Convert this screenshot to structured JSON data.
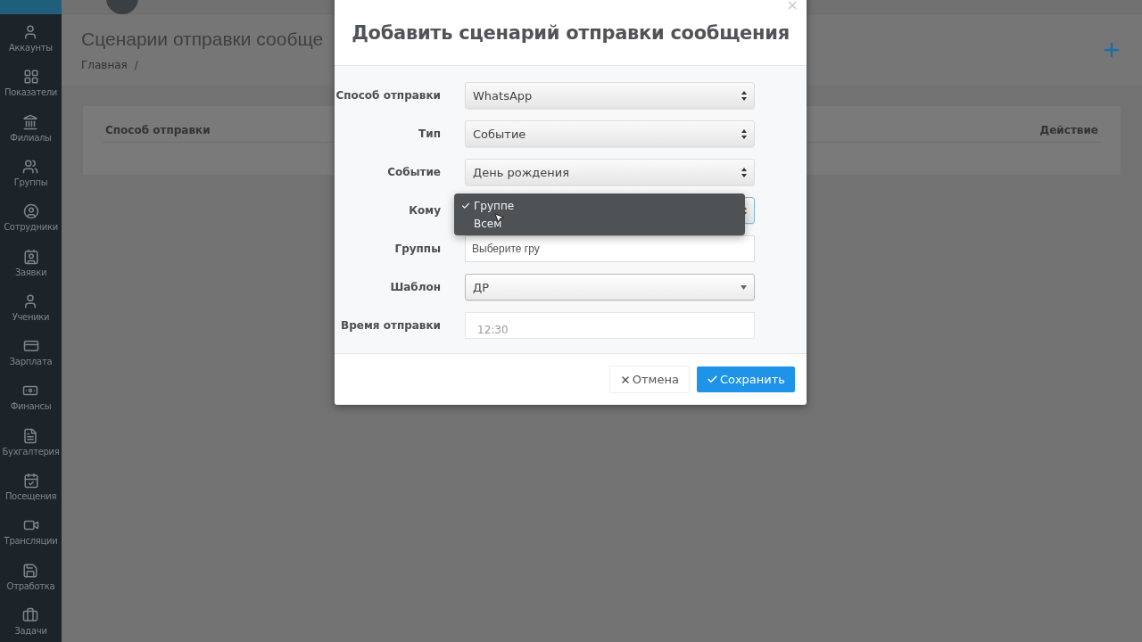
{
  "sidebar": {
    "items": [
      {
        "label": "Аккаунты"
      },
      {
        "label": "Показатели"
      },
      {
        "label": "Филиалы"
      },
      {
        "label": "Группы"
      },
      {
        "label": "Сотрудники"
      },
      {
        "label": "Заявки"
      },
      {
        "label": "Ученики"
      },
      {
        "label": "Зарплата"
      },
      {
        "label": "Финансы"
      },
      {
        "label": "Бухгалтерия"
      },
      {
        "label": "Посещения"
      },
      {
        "label": "Трансляции"
      },
      {
        "label": "Отработка"
      },
      {
        "label": "Задачи"
      }
    ]
  },
  "page": {
    "title": "Сценарии отправки сообще",
    "breadcrumb": "Главная",
    "breadcrumb_separator": "/"
  },
  "table": {
    "columns": [
      "Способ отправки",
      "Действие"
    ]
  },
  "modal": {
    "title": "Добавить сценарий отправки сообщения",
    "close": "×",
    "fields": [
      {
        "label": "Способ отправки",
        "kind": "select",
        "value": "WhatsApp"
      },
      {
        "label": "Тип",
        "kind": "select",
        "value": "Событие"
      },
      {
        "label": "Событие",
        "kind": "select",
        "value": "День рождения"
      },
      {
        "label": "Кому",
        "kind": "open-select",
        "options": [
          {
            "label": "Группе",
            "selected": true
          },
          {
            "label": "Всем",
            "selected": false
          }
        ]
      },
      {
        "label": "Группы",
        "kind": "input",
        "placeholder": "Выберите гру"
      },
      {
        "label": "Шаблон",
        "kind": "dropdown",
        "value": "ДР"
      },
      {
        "label": "Время отправки",
        "kind": "time",
        "placeholder": "12:30"
      }
    ],
    "buttons": [
      {
        "label": "Отмена",
        "kind": "cancel"
      },
      {
        "label": "Сохранить",
        "kind": "save"
      }
    ]
  }
}
